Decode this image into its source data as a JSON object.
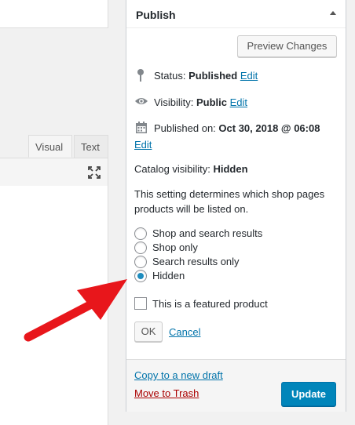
{
  "editor": {
    "tabs": [
      "Visual",
      "Text"
    ],
    "fullscreen_icon": "fullscreen-expand-icon"
  },
  "publish": {
    "title": "Publish",
    "preview_button": "Preview Changes",
    "status_label": "Status:",
    "status_value": "Published",
    "visibility_label": "Visibility:",
    "visibility_value": "Public",
    "published_label": "Published on:",
    "published_value": "Oct 30, 2018 @ 06:08",
    "edit_label": "Edit",
    "catalog_label": "Catalog visibility:",
    "catalog_value": "Hidden",
    "help_text_line1": "This setting determines which shop pages",
    "help_text_line2": "products will be listed on.",
    "options": [
      {
        "label": "Shop and search results",
        "checked": false
      },
      {
        "label": "Shop only",
        "checked": false
      },
      {
        "label": "Search results only",
        "checked": false
      },
      {
        "label": "Hidden",
        "checked": true
      }
    ],
    "featured_label": "This is a featured product",
    "featured_checked": false,
    "ok_button": "OK",
    "cancel_link": "Cancel",
    "copy_draft_link": "Copy to a new draft",
    "trash_link": "Move to Trash",
    "update_button": "Update"
  },
  "colors": {
    "link": "#0073aa",
    "trash": "#a00",
    "update_bg": "#0085ba",
    "radio_dot": "#1e8cbe",
    "annotation_arrow": "#e8161b"
  }
}
